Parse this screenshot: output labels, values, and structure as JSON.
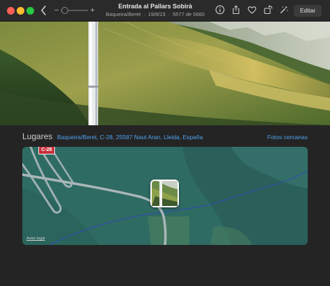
{
  "toolbar": {
    "title": "Entrada al Pallars Sobirà",
    "location": "Baqueira/Beret",
    "date": "19/8/23",
    "count": "5577 de 5660",
    "edit_label": "Editar",
    "zoom_minus": "−",
    "zoom_plus": "+",
    "zoom_level": 0.1
  },
  "icons": [
    "back-chevron-icon",
    "info-icon",
    "share-icon",
    "heart-icon",
    "rotate-icon",
    "magic-wand-icon"
  ],
  "places": {
    "heading": "Lugares",
    "address": "Baqueira/Beret, C-28, 25587 Naut Aran, Lleida, España",
    "nearby_link": "Fotos cercanas",
    "road_label": "C-28",
    "legal_link": "Aviso legal"
  },
  "colors": {
    "accent": "#4fa3f0",
    "map_base": "#2e6b63",
    "road_badge": "#c8313a",
    "window_bg": "#1e1e1e"
  }
}
